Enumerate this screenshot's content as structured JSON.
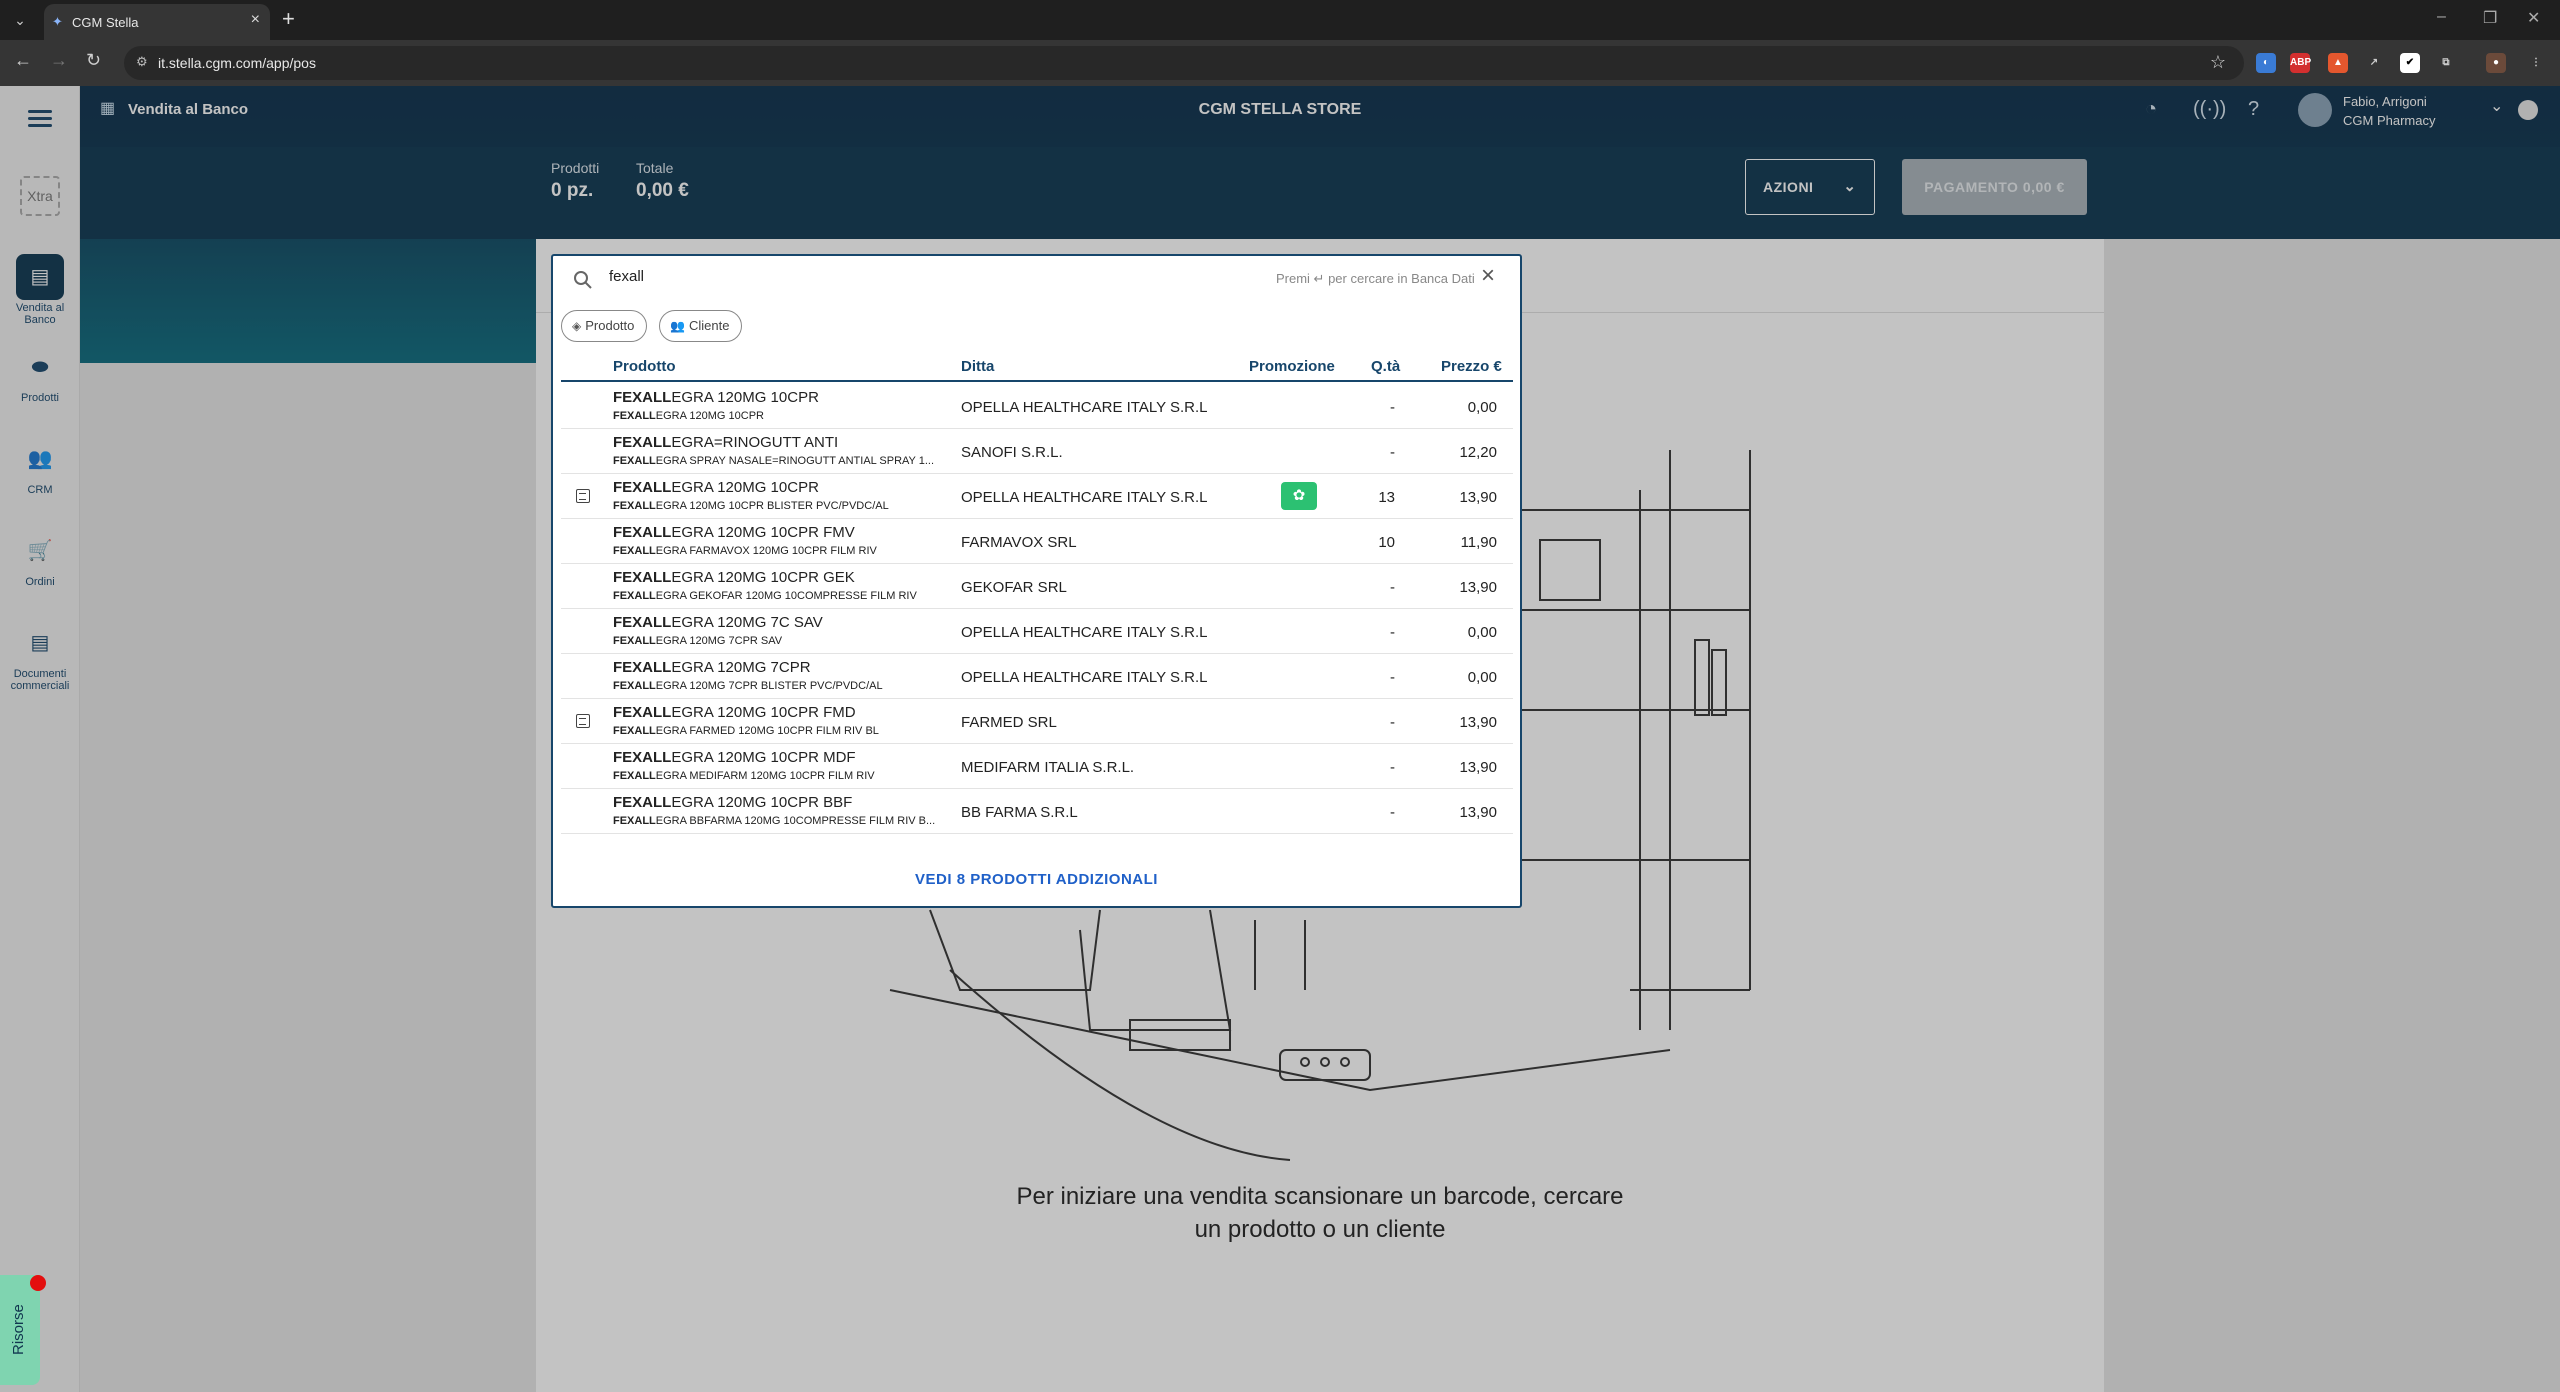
{
  "browser": {
    "tab_title": "CGM Stella",
    "url": "it.stella.cgm.com/app/pos"
  },
  "header": {
    "app_title": "Vendita al Banco",
    "store_name": "CGM STELLA STORE",
    "user_name": "Fabio, Arrigoni",
    "user_org": "CGM Pharmacy"
  },
  "sidebar": {
    "xtra": "Xtra",
    "items": [
      {
        "label": "Vendita al Banco",
        "icon": "register-icon"
      },
      {
        "label": "Prodotti",
        "icon": "pill-icon"
      },
      {
        "label": "CRM",
        "icon": "people-icon"
      },
      {
        "label": "Ordini",
        "icon": "cart-icon"
      },
      {
        "label": "Documenti commerciali",
        "icon": "document-icon"
      }
    ],
    "risorse": "Risorse"
  },
  "summary": {
    "prodotti_label": "Prodotti",
    "prodotti_value": "0 pz.",
    "totale_label": "Totale",
    "totale_value": "0,00 €",
    "azioni": "AZIONI",
    "pagamento": "PAGAMENTO 0,00 €"
  },
  "search": {
    "query": "fexall",
    "hint": "Premi ↵ per cercare in Banca Dati",
    "chips": [
      "Prodotto",
      "Cliente"
    ],
    "columns": {
      "prodotto": "Prodotto",
      "ditta": "Ditta",
      "promozione": "Promozione",
      "qta": "Q.tà",
      "prezzo": "Prezzo €"
    },
    "rows": [
      {
        "match": "FEXALL",
        "name": "EGRA 120MG 10CPR",
        "sub_match": "FEXALL",
        "sub": "EGRA 120MG 10CPR",
        "ditta": "OPELLA HEALTHCARE ITALY S.R.L",
        "promo": false,
        "qta": "-",
        "prezzo": "0,00",
        "icon": false
      },
      {
        "match": "FEXALL",
        "name": "EGRA=RINOGUTT ANTI",
        "sub_match": "FEXALL",
        "sub": "EGRA SPRAY NASALE=RINOGUTT ANTIAL SPRAY 1...",
        "ditta": "SANOFI S.R.L.",
        "promo": false,
        "qta": "-",
        "prezzo": "12,20",
        "icon": false
      },
      {
        "match": "FEXALL",
        "name": "EGRA 120MG 10CPR",
        "sub_match": "FEXALL",
        "sub": "EGRA 120MG 10CPR BLISTER PVC/PVDC/AL",
        "ditta": "OPELLA HEALTHCARE ITALY S.R.L",
        "promo": true,
        "qta": "13",
        "prezzo": "13,90",
        "icon": true
      },
      {
        "match": "FEXALL",
        "name": "EGRA 120MG 10CPR FMV",
        "sub_match": "FEXALL",
        "sub": "EGRA FARMAVOX 120MG 10CPR FILM RIV",
        "ditta": "FARMAVOX SRL",
        "promo": false,
        "qta": "10",
        "prezzo": "11,90",
        "icon": false
      },
      {
        "match": "FEXALL",
        "name": "EGRA 120MG 10CPR GEK",
        "sub_match": "FEXALL",
        "sub": "EGRA GEKOFAR 120MG 10COMPRESSE FILM RIV",
        "ditta": "GEKOFAR SRL",
        "promo": false,
        "qta": "-",
        "prezzo": "13,90",
        "icon": false
      },
      {
        "match": "FEXALL",
        "name": "EGRA 120MG 7C SAV",
        "sub_match": "FEXALL",
        "sub": "EGRA 120MG 7CPR SAV",
        "ditta": "OPELLA HEALTHCARE ITALY S.R.L",
        "promo": false,
        "qta": "-",
        "prezzo": "0,00",
        "icon": false
      },
      {
        "match": "FEXALL",
        "name": "EGRA 120MG 7CPR",
        "sub_match": "FEXALL",
        "sub": "EGRA 120MG 7CPR BLISTER PVC/PVDC/AL",
        "ditta": "OPELLA HEALTHCARE ITALY S.R.L",
        "promo": false,
        "qta": "-",
        "prezzo": "0,00",
        "icon": false
      },
      {
        "match": "FEXALL",
        "name": "EGRA 120MG 10CPR FMD",
        "sub_match": "FEXALL",
        "sub": "EGRA FARMED 120MG 10CPR FILM RIV BL",
        "ditta": "FARMED SRL",
        "promo": false,
        "qta": "-",
        "prezzo": "13,90",
        "icon": true
      },
      {
        "match": "FEXALL",
        "name": "EGRA 120MG 10CPR MDF",
        "sub_match": "FEXALL",
        "sub": "EGRA MEDIFARM 120MG 10CPR FILM RIV",
        "ditta": "MEDIFARM ITALIA S.R.L.",
        "promo": false,
        "qta": "-",
        "prezzo": "13,90",
        "icon": false
      },
      {
        "match": "FEXALL",
        "name": "EGRA 120MG 10CPR BBF",
        "sub_match": "FEXALL",
        "sub": "EGRA BBFARMA 120MG 10COMPRESSE FILM RIV B...",
        "ditta": "BB FARMA S.R.L",
        "promo": false,
        "qta": "-",
        "prezzo": "13,90",
        "icon": false
      }
    ],
    "more": "VEDI 8 PRODOTTI ADDIZIONALI"
  },
  "empty_state": {
    "message": "Per iniziare una vendita scansionare un barcode, cercare un prodotto o un cliente"
  },
  "colors": {
    "header_bg": "#0c3550",
    "accent": "#17466b",
    "promo": "#2cc172",
    "link": "#1f60c8"
  }
}
